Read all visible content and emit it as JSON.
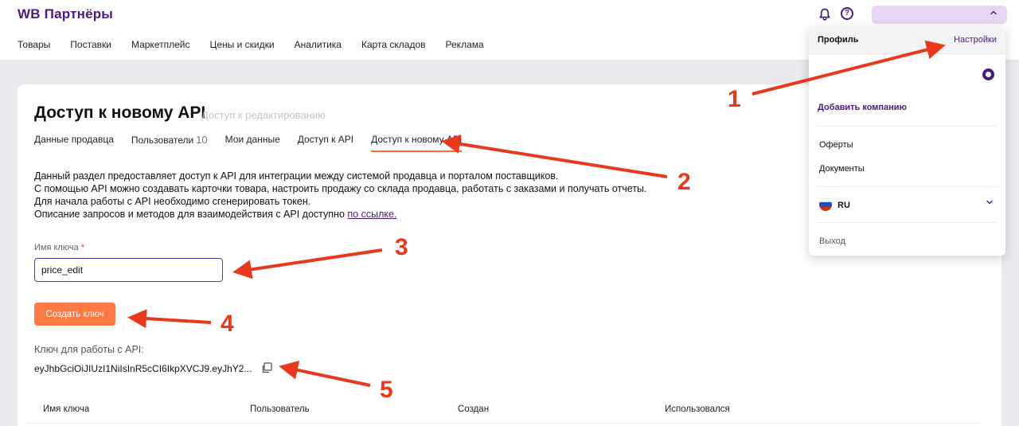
{
  "header": {
    "logo": "WB Партнёры",
    "nav": [
      "Товары",
      "Поставки",
      "Маркетплейс",
      "Цены и скидки",
      "Аналитика",
      "Карта складов",
      "Реклама"
    ],
    "icons": [
      "bell-icon",
      "help-icon"
    ],
    "help_glyph": "?"
  },
  "page": {
    "title": "Доступ к новому API",
    "subtitle": "Доступ к редактированию",
    "tabs": [
      {
        "label": "Данные продавца"
      },
      {
        "label": "Пользователи",
        "count": "10"
      },
      {
        "label": "Мои данные"
      },
      {
        "label": "Доступ к API"
      },
      {
        "label": "Доступ к новому API",
        "active": true
      }
    ],
    "description": [
      "Данный раздел предоставляет доступ к API для интеграции между системой продавца и порталом поставщиков.",
      "С помощью API можно создавать карточки товара, настроить продажу со склада продавца, работать с заказами и получать отчеты.",
      "Для начала работы с API необходимо сгенерировать токен.",
      "Описание запросов и методов для взаимодействия с API доступно"
    ],
    "link_text": "по ссылке.",
    "key_label": "Имя ключа",
    "required_mark": "*",
    "key_value": "price_edit",
    "create_button": "Создать ключ",
    "token_label": "Ключ для работы с API:",
    "token_value": "eyJhbGciOiJIUzI1NiIsInR5cCI6IkpXVCJ9.eyJhY2...",
    "table_headers": [
      "Имя ключа",
      "Пользователь",
      "Создан",
      "Использовался"
    ]
  },
  "dropdown": {
    "profile": "Профиль",
    "settings": "Настройки",
    "add_company": "Добавить компанию",
    "offers": "Оферты",
    "documents": "Документы",
    "language": "RU",
    "exit": "Выход"
  },
  "annotations": [
    "1",
    "2",
    "3",
    "4",
    "5"
  ],
  "colors": {
    "brand": "#4b1a7c",
    "accent_button": "#ff7a45",
    "annotation": "#e8391c",
    "tab_underline": "#ff6a3d"
  }
}
